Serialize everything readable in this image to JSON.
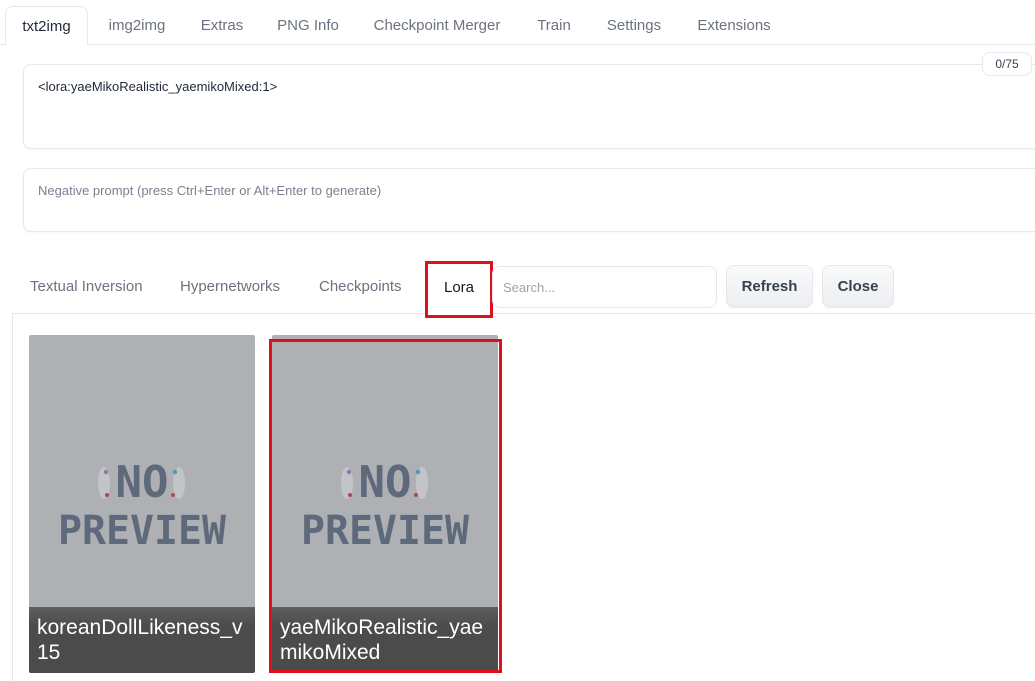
{
  "main_tabs": [
    {
      "label": "txt2img",
      "active": true
    },
    {
      "label": "img2img"
    },
    {
      "label": "Extras"
    },
    {
      "label": "PNG Info"
    },
    {
      "label": "Checkpoint Merger"
    },
    {
      "label": "Train"
    },
    {
      "label": "Settings"
    },
    {
      "label": "Extensions"
    }
  ],
  "prompt": {
    "value": "<lora:yaeMikoRealistic_yaemikoMixed:1>",
    "token_counter": "0/75"
  },
  "negative_prompt": {
    "placeholder": "Negative prompt (press Ctrl+Enter or Alt+Enter to generate)"
  },
  "extra_networks": {
    "tabs": [
      {
        "label": "Textual Inversion"
      },
      {
        "label": "Hypernetworks"
      },
      {
        "label": "Checkpoints"
      },
      {
        "label": "Lora",
        "active": true
      }
    ],
    "search_placeholder": "Search...",
    "refresh_label": "Refresh",
    "close_label": "Close",
    "cards": [
      {
        "name": "koreanDollLikeness_v15",
        "preview_text_line1": "NO",
        "preview_text_line2": "PREVIEW"
      },
      {
        "name": "yaeMikoRealistic_yaemikoMixed",
        "preview_text_line1": "NO",
        "preview_text_line2": "PREVIEW"
      }
    ]
  },
  "colors": {
    "highlight": "#e0101a",
    "placeholder_text": "#5f6b7d",
    "card_bg": "#aeb0b4"
  }
}
